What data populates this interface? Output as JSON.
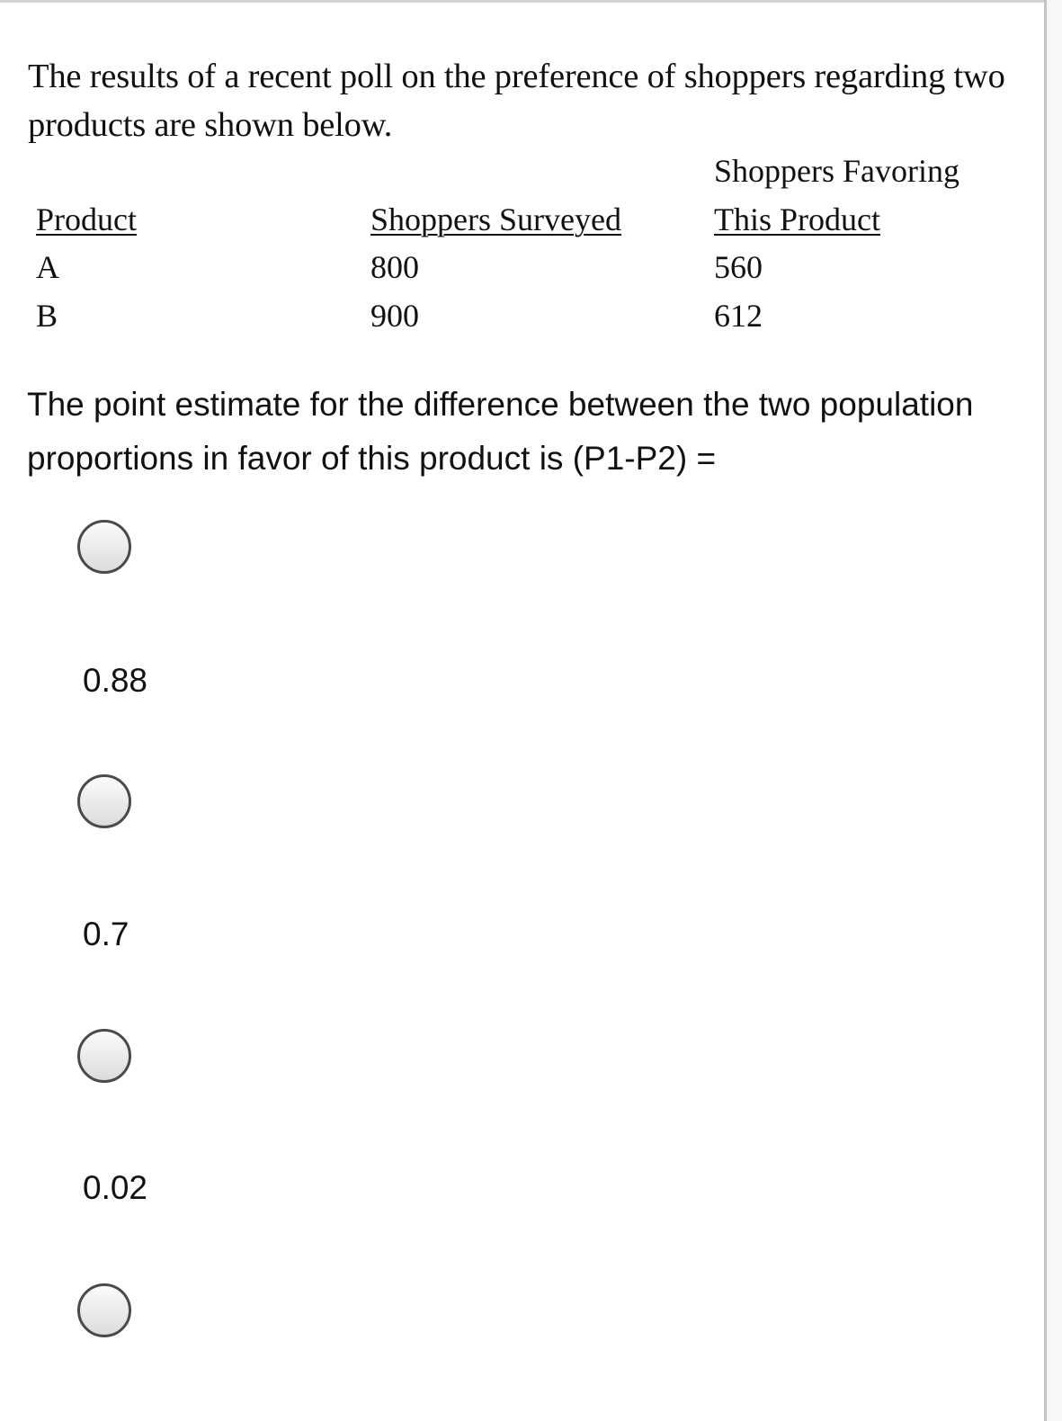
{
  "intro": "The results of a recent poll on the preference of shoppers regarding two products are shown below.",
  "table": {
    "headers": {
      "product": "Product",
      "surveyed": "Shoppers Surveyed",
      "favoring_line1": "Shoppers Favoring",
      "favoring_line2": "This Product"
    },
    "rows": [
      {
        "product": "A",
        "surveyed": "800",
        "favoring": "560"
      },
      {
        "product": "B",
        "surveyed": "900",
        "favoring": "612"
      }
    ]
  },
  "question": "The point estimate for the difference  between the two population proportions in favor of this product is (P1-P2) =",
  "options": [
    {
      "label": "",
      "selected": false
    },
    {
      "label": "0.88",
      "selected": false
    },
    {
      "label": "0.7",
      "selected": false
    },
    {
      "label": "0.02",
      "selected": false
    }
  ]
}
